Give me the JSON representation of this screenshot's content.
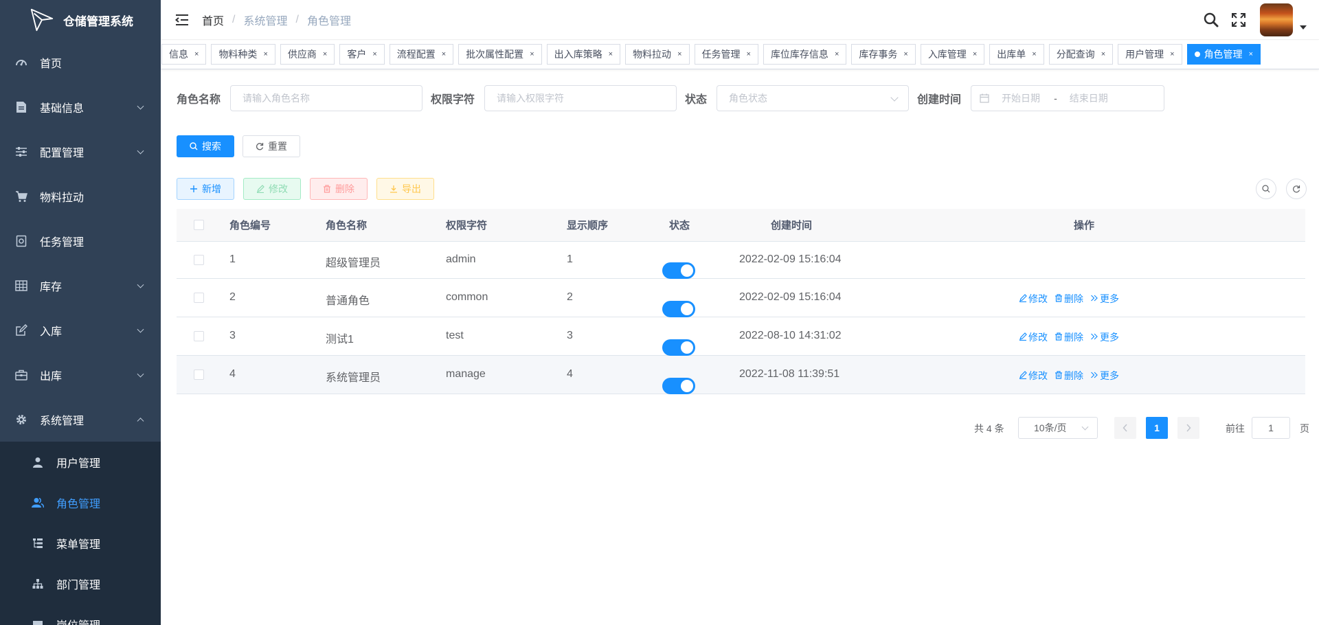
{
  "app": {
    "title": "仓储管理系统"
  },
  "sidebar": {
    "items": [
      {
        "label": "首页",
        "icon": "dashboard-icon",
        "has_arrow": false
      },
      {
        "label": "基础信息",
        "icon": "document-icon",
        "has_arrow": true
      },
      {
        "label": "配置管理",
        "icon": "sliders-icon",
        "has_arrow": true
      },
      {
        "label": "物料拉动",
        "icon": "cart-icon",
        "has_arrow": false
      },
      {
        "label": "任务管理",
        "icon": "task-icon",
        "has_arrow": false
      },
      {
        "label": "库存",
        "icon": "grid-icon",
        "has_arrow": true
      },
      {
        "label": "入库",
        "icon": "edit-icon",
        "has_arrow": true
      },
      {
        "label": "出库",
        "icon": "box-icon",
        "has_arrow": true
      },
      {
        "label": "系统管理",
        "icon": "gear-icon",
        "has_arrow": true,
        "expanded": true
      }
    ],
    "submenu": [
      {
        "label": "用户管理",
        "icon": "user-icon",
        "active": false
      },
      {
        "label": "角色管理",
        "icon": "users-icon",
        "active": true
      },
      {
        "label": "菜单管理",
        "icon": "tree-table-icon",
        "active": false
      },
      {
        "label": "部门管理",
        "icon": "org-tree-icon",
        "active": false
      },
      {
        "label": "岗位管理",
        "icon": "post-icon",
        "active": false
      }
    ]
  },
  "breadcrumb": [
    "首页",
    "系统管理",
    "角色管理"
  ],
  "tags": [
    "信息",
    "物料种类",
    "供应商",
    "客户",
    "流程配置",
    "批次属性配置",
    "出入库策略",
    "物料拉动",
    "任务管理",
    "库位库存信息",
    "库存事务",
    "入库管理",
    "出库单",
    "分配查询",
    "用户管理",
    "角色管理"
  ],
  "active_tag": "角色管理",
  "search": {
    "role_name_label": "角色名称",
    "role_name_placeholder": "请输入角色名称",
    "perm_label": "权限字符",
    "perm_placeholder": "请输入权限字符",
    "status_label": "状态",
    "status_placeholder": "角色状态",
    "created_label": "创建时间",
    "start_placeholder": "开始日期",
    "range_sep": "-",
    "end_placeholder": "结束日期",
    "search_btn": "搜索",
    "reset_btn": "重置"
  },
  "toolbar": {
    "add": "新增",
    "edit": "修改",
    "delete": "删除",
    "export": "导出"
  },
  "table": {
    "headers": [
      "角色编号",
      "角色名称",
      "权限字符",
      "显示顺序",
      "状态",
      "创建时间",
      "操作"
    ],
    "rows": [
      {
        "id": "1",
        "name": "超级管理员",
        "key": "admin",
        "order": "1",
        "enabled": true,
        "created": "2022-02-09 15:16:04",
        "ops": false
      },
      {
        "id": "2",
        "name": "普通角色",
        "key": "common",
        "order": "2",
        "enabled": true,
        "created": "2022-02-09 15:16:04",
        "ops": true
      },
      {
        "id": "3",
        "name": "测试1",
        "key": "test",
        "order": "3",
        "enabled": true,
        "created": "2022-08-10 14:31:02",
        "ops": true
      },
      {
        "id": "4",
        "name": "系统管理员",
        "key": "manage",
        "order": "4",
        "enabled": true,
        "created": "2022-11-08 11:39:51",
        "ops": true
      }
    ],
    "op_edit": "修改",
    "op_delete": "删除",
    "op_more": "更多"
  },
  "pagination": {
    "total": "共 4 条",
    "page_size": "10条/页",
    "current_page": "1",
    "goto_label": "前往",
    "goto_value": "1",
    "goto_unit": "页"
  },
  "colors": {
    "primary": "#1890ff",
    "sidebar_bg": "#304156",
    "submenu_bg": "#1f2d3d"
  }
}
